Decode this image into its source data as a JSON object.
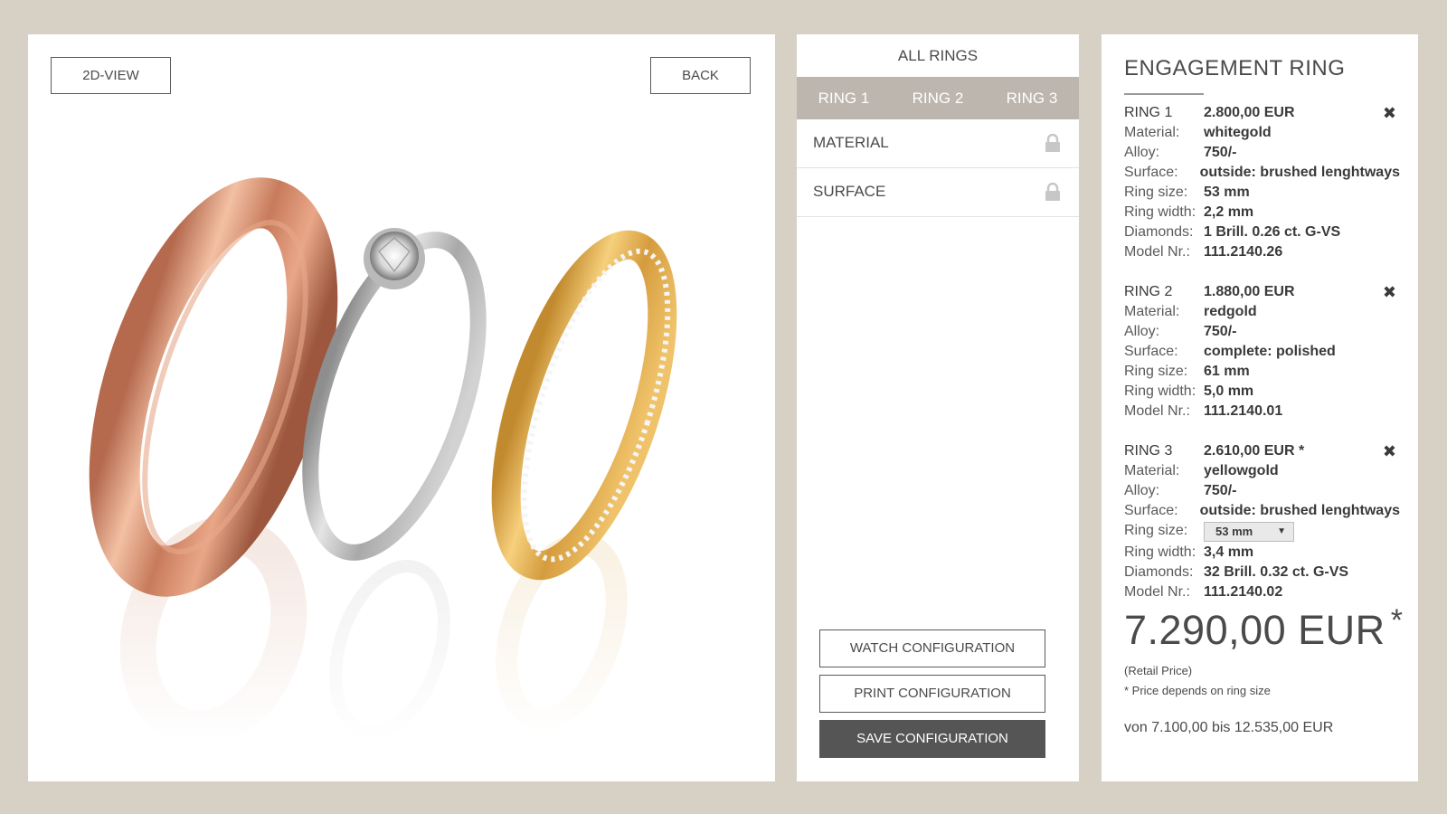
{
  "viewer": {
    "view_button": "2D-VIEW",
    "back_button": "BACK"
  },
  "config": {
    "all_rings": "ALL RINGS",
    "tabs": [
      "RING 1",
      "RING 2",
      "RING 3"
    ],
    "options": [
      "MATERIAL",
      "SURFACE"
    ],
    "lock_icon": "lock-icon",
    "watch_label": "WATCH CONFIGURATION",
    "print_label": "PRINT CONFIGURATION",
    "save_label": "SAVE CONFIGURATION"
  },
  "summary": {
    "title": "ENGAGEMENT RING",
    "remove_icon": "close-icon",
    "rings": [
      {
        "name": "RING 1",
        "price": "2.800,00 EUR",
        "rows": [
          {
            "label": "Material:",
            "value": "whitegold"
          },
          {
            "label": "Alloy:",
            "value": "750/-"
          },
          {
            "label": "Surface:",
            "value": "outside: brushed lenghtways"
          },
          {
            "label": "Ring size:",
            "value": "53 mm"
          },
          {
            "label": "Ring width:",
            "value": "2,2 mm"
          },
          {
            "label": "Diamonds:",
            "value": "1 Brill. 0.26 ct. G-VS"
          },
          {
            "label": "Model Nr.:",
            "value": "111.2140.26"
          }
        ]
      },
      {
        "name": "RING 2",
        "price": "1.880,00 EUR",
        "rows": [
          {
            "label": "Material:",
            "value": "redgold"
          },
          {
            "label": "Alloy:",
            "value": "750/-"
          },
          {
            "label": "Surface:",
            "value": "complete: polished"
          },
          {
            "label": "Ring size:",
            "value": "61 mm"
          },
          {
            "label": "Ring width:",
            "value": "5,0 mm"
          },
          {
            "label": "Model Nr.:",
            "value": "111.2140.01"
          }
        ]
      },
      {
        "name": "RING 3",
        "price": "2.610,00 EUR *",
        "rows": [
          {
            "label": "Material:",
            "value": "yellowgold"
          },
          {
            "label": "Alloy:",
            "value": "750/-"
          },
          {
            "label": "Surface:",
            "value": "outside: brushed lenghtways"
          },
          {
            "label": "Ring size:",
            "value": "53 mm"
          },
          {
            "label": "Ring width:",
            "value": "3,4 mm"
          },
          {
            "label": "Diamonds:",
            "value": "32 Brill. 0.32 ct. G-VS"
          },
          {
            "label": "Model Nr.:",
            "value": "111.2140.02"
          }
        ]
      }
    ],
    "total": "7.290,00 EUR",
    "total_star": "*",
    "retail_note": "(Retail Price)",
    "footnote": "* Price depends on ring size",
    "range": "von 7.100,00 bis 12.535,00 EUR"
  },
  "colors": {
    "background": "#d7d0c5",
    "tab_bar": "#bdb6ae",
    "save_button": "#555555"
  }
}
